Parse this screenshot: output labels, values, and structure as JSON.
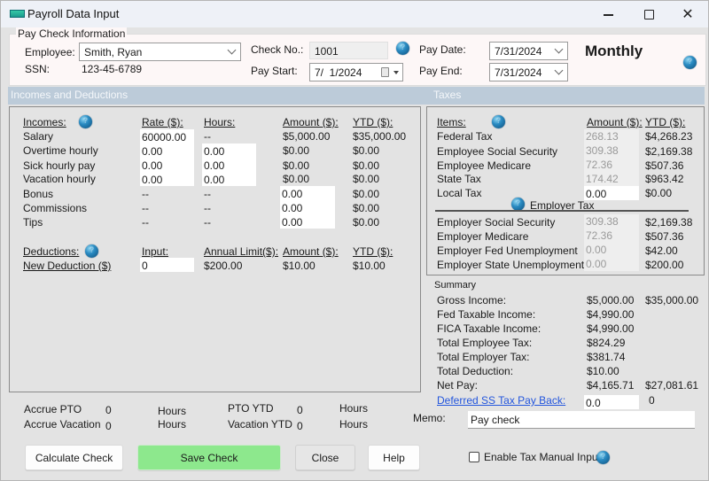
{
  "window": {
    "title": "Payroll Data Input",
    "controls": {
      "minimize": "minimize",
      "maximize": "maximize",
      "close": "close"
    }
  },
  "paycheck_info": {
    "legend": "Pay Check Information",
    "employee_label": "Employee:",
    "employee_value": "Smith, Ryan",
    "ssn_label": "SSN:",
    "ssn_value": "123-45-6789",
    "check_no_label": "Check No.:",
    "check_no_value": "1001",
    "pay_start_label": "Pay Start:",
    "pay_start_value": "7/  1/2024",
    "pay_date_label": "Pay Date:",
    "pay_date_value": "7/31/2024",
    "pay_end_label": "Pay End:",
    "pay_end_value": "7/31/2024",
    "frequency": "Monthly"
  },
  "incomes_deductions": {
    "section_title": "Incomes and Deductions",
    "incomes_header": "Incomes:",
    "rate_header": "Rate ($):",
    "hours_header": "Hours:",
    "amount_header": "Amount ($):",
    "ytd_header": "YTD ($):",
    "incomes": [
      {
        "label": "Salary",
        "rate": "60000.00",
        "hours": "--",
        "amount": "$5,000.00",
        "ytd": "$35,000.00"
      },
      {
        "label": "Overtime hourly",
        "rate": "0.00",
        "hours": "0.00",
        "amount": "$0.00",
        "ytd": "$0.00"
      },
      {
        "label": "Sick hourly pay",
        "rate": "0.00",
        "hours": "0.00",
        "amount": "$0.00",
        "ytd": "$0.00"
      },
      {
        "label": "Vacation hourly",
        "rate": "0.00",
        "hours": "0.00",
        "amount": "$0.00",
        "ytd": "$0.00"
      },
      {
        "label": "Bonus",
        "rate": "--",
        "hours": "--",
        "amount": "0.00",
        "ytd": "$0.00"
      },
      {
        "label": "Commissions",
        "rate": "--",
        "hours": "--",
        "amount": "0.00",
        "ytd": "$0.00"
      },
      {
        "label": "Tips",
        "rate": "--",
        "hours": "--",
        "amount": "0.00",
        "ytd": "$0.00"
      }
    ],
    "deductions_header": "Deductions:",
    "input_header": "Input:",
    "annual_limit_header": "Annual Limit($):",
    "ded_amount_header": "Amount ($):",
    "ded_ytd_header": "YTD ($):",
    "deductions": [
      {
        "label": "New Deduction  ($)",
        "input": "0",
        "annual_limit": "$200.00",
        "amount": "$10.00",
        "ytd": "$10.00"
      }
    ]
  },
  "taxes": {
    "section_title": "Taxes",
    "items_header": "Items:",
    "amount_header": "Amount ($):",
    "ytd_header": "YTD ($):",
    "employee_taxes": [
      {
        "label": "Federal Tax",
        "amount": "268.13",
        "ytd": "$4,268.23"
      },
      {
        "label": "Employee Social Security",
        "amount": "309.38",
        "ytd": "$2,169.38"
      },
      {
        "label": "Employee Medicare",
        "amount": "72.36",
        "ytd": "$507.36"
      },
      {
        "label": "State Tax",
        "amount": "174.42",
        "ytd": "$963.42"
      },
      {
        "label": "Local Tax",
        "amount": "0.00",
        "ytd": "$0.00"
      }
    ],
    "employer_tax_title": "Employer Tax",
    "employer_taxes": [
      {
        "label": "Employer Social Security",
        "amount": "309.38",
        "ytd": "$2,169.38"
      },
      {
        "label": "Employer Medicare",
        "amount": "72.36",
        "ytd": "$507.36"
      },
      {
        "label": "Employer Fed Unemployment",
        "amount": "0.00",
        "ytd": "$42.00"
      },
      {
        "label": "Employer State Unemployment",
        "amount": "0.00",
        "ytd": "$200.00"
      }
    ]
  },
  "summary": {
    "title": "Summary",
    "rows": [
      {
        "label": "Gross Income:",
        "current": "$5,000.00",
        "ytd": "$35,000.00"
      },
      {
        "label": "Fed Taxable Income:",
        "current": "$4,990.00",
        "ytd": ""
      },
      {
        "label": "FICA Taxable Income:",
        "current": "$4,990.00",
        "ytd": ""
      },
      {
        "label": "Total Employee Tax:",
        "current": "$824.29",
        "ytd": ""
      },
      {
        "label": "Total Employer Tax:",
        "current": "$381.74",
        "ytd": ""
      },
      {
        "label": "Total Deduction:",
        "current": "$10.00",
        "ytd": ""
      },
      {
        "label": "Net Pay:",
        "current": "$4,165.71",
        "ytd": "$27,081.61"
      }
    ],
    "deferred_ss_label": "Deferred SS Tax Pay Back:",
    "deferred_ss_input": "0.0",
    "deferred_ss_value": "0"
  },
  "accruals": {
    "accrue_pto_label": "Accrue PTO",
    "accrue_pto_value": "0",
    "accrue_pto_unit": "Hours",
    "accrue_vacation_label": "Accrue Vacation",
    "accrue_vacation_value": "0",
    "accrue_vacation_unit": "Hours",
    "pto_ytd_label": "PTO YTD",
    "pto_ytd_value": "0",
    "pto_ytd_unit": "Hours",
    "vacation_ytd_label": "Vacation YTD",
    "vacation_ytd_value": "0",
    "vacation_ytd_unit": "Hours"
  },
  "memo": {
    "label": "Memo:",
    "value": "Pay check"
  },
  "buttons": {
    "calculate": "Calculate Check",
    "save": "Save Check",
    "close": "Close",
    "help": "Help"
  },
  "enable_tax_manual": {
    "label": "Enable Tax Manual Input",
    "checked": false
  },
  "colors": {
    "save_button": "#8de88d",
    "section_bar": "#bccbd9",
    "link": "#2255dd",
    "paycheck_bg": "#fdf7f7"
  }
}
